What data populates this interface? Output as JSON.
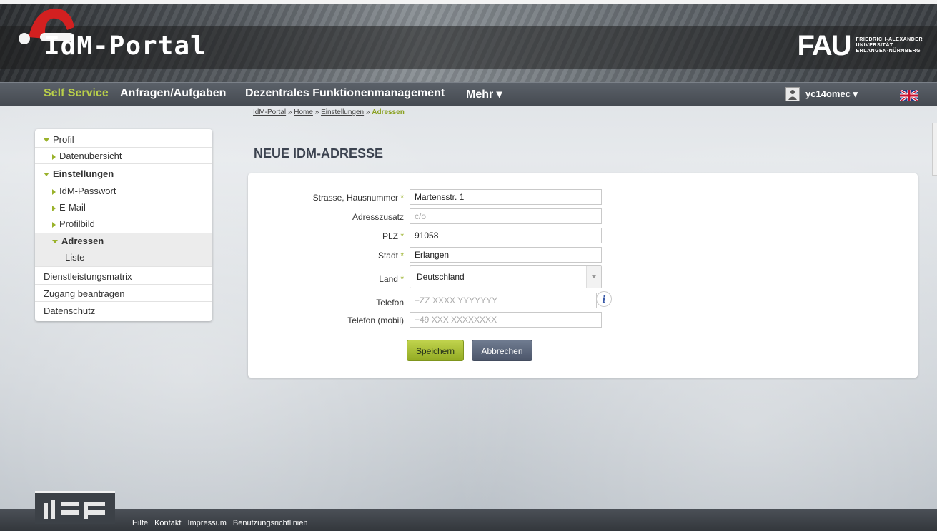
{
  "header": {
    "logo_text": "IdM-Portal",
    "fau_mark": "FAU",
    "fau_line1": "FRIEDRICH-ALEXANDER",
    "fau_line2": "UNIVERSITÄT",
    "fau_line3": "ERLANGEN-NÜRNBERG"
  },
  "nav": {
    "items": [
      {
        "label": "Self Service",
        "active": true
      },
      {
        "label": "Anfragen/Aufgaben"
      },
      {
        "label": "Dezentrales Funktionenmanagement"
      },
      {
        "label": "Mehr ▾"
      }
    ],
    "user": "yc14omec ▾",
    "language_icon": "uk-flag-icon"
  },
  "breadcrumb": {
    "items": [
      "IdM-Portal",
      "Home",
      "Einstellungen"
    ],
    "separator": "»",
    "current": "Adressen"
  },
  "sidebar": {
    "items": [
      {
        "label": "Profil"
      },
      {
        "label": "Datenübersicht"
      },
      {
        "label": "Einstellungen"
      },
      {
        "label": "IdM-Passwort"
      },
      {
        "label": "E-Mail"
      },
      {
        "label": "Profilbild"
      },
      {
        "label": "Adressen"
      },
      {
        "label": "Liste"
      },
      {
        "label": "Dienstleistungsmatrix"
      },
      {
        "label": "Zugang beantragen"
      },
      {
        "label": "Datenschutz"
      }
    ]
  },
  "page": {
    "title": "NEUE IDM-ADRESSE"
  },
  "form": {
    "required_marker": "*",
    "street": {
      "label": "Strasse, Hausnummer",
      "value": "Martensstr. 1"
    },
    "addition": {
      "label": "Adresszusatz",
      "placeholder": "c/o"
    },
    "zip": {
      "label": "PLZ",
      "value": "91058"
    },
    "city": {
      "label": "Stadt",
      "value": "Erlangen"
    },
    "country": {
      "label": "Land",
      "value": "Deutschland"
    },
    "phone": {
      "label": "Telefon",
      "placeholder": "+ZZ XXXX YYYYYYY",
      "info": "i"
    },
    "mobile": {
      "label": "Telefon (mobil)",
      "placeholder": "+49 XXX XXXXXXXX"
    },
    "save_label": "Speichern",
    "cancel_label": "Abbrechen"
  },
  "footer": {
    "links": [
      "Hilfe",
      "Kontakt",
      "Impressum",
      "Benutzungsrichtlinien"
    ]
  },
  "colors": {
    "accent_green": "#9ab22b",
    "nav_bg": "#4b5057",
    "title_color": "#3c4350"
  }
}
